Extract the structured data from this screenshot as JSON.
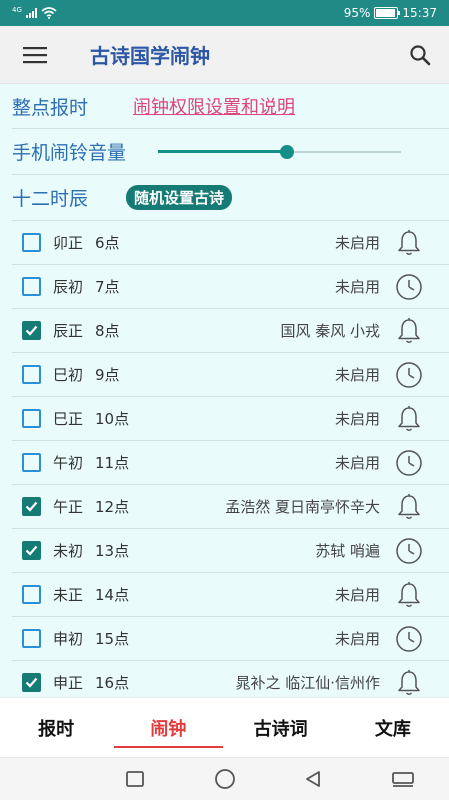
{
  "status_bar": {
    "network": "4G",
    "battery": "95%",
    "battery_level": 0.95,
    "time": "15:37"
  },
  "app_bar": {
    "title": "古诗国学闹钟",
    "menu_icon": "hamburger-menu-icon",
    "search_icon": "search-icon"
  },
  "settings": {
    "hourly_label": "整点报时",
    "permission_link": "闹钟权限设置和说明",
    "volume_label": "手机闹铃音量",
    "volume_level": 0.53,
    "period_label": "十二时辰",
    "random_button": "随机设置古诗"
  },
  "alarms": [
    {
      "slot": "卯正",
      "hour": "6点",
      "poem": "未启用",
      "checked": false,
      "icon": "bell-icon"
    },
    {
      "slot": "辰初",
      "hour": "7点",
      "poem": "未启用",
      "checked": false,
      "icon": "clock-icon"
    },
    {
      "slot": "辰正",
      "hour": "8点",
      "poem": "国风 秦风 小戎",
      "checked": true,
      "icon": "bell-icon"
    },
    {
      "slot": "巳初",
      "hour": "9点",
      "poem": "未启用",
      "checked": false,
      "icon": "clock-icon"
    },
    {
      "slot": "巳正",
      "hour": "10点",
      "poem": "未启用",
      "checked": false,
      "icon": "bell-icon"
    },
    {
      "slot": "午初",
      "hour": "11点",
      "poem": "未启用",
      "checked": false,
      "icon": "clock-icon"
    },
    {
      "slot": "午正",
      "hour": "12点",
      "poem": "孟浩然 夏日南亭怀辛大",
      "checked": true,
      "icon": "bell-icon"
    },
    {
      "slot": "未初",
      "hour": "13点",
      "poem": "苏轼 哨遍",
      "checked": true,
      "icon": "clock-icon"
    },
    {
      "slot": "未正",
      "hour": "14点",
      "poem": "未启用",
      "checked": false,
      "icon": "bell-icon"
    },
    {
      "slot": "申初",
      "hour": "15点",
      "poem": "未启用",
      "checked": false,
      "icon": "clock-icon"
    },
    {
      "slot": "申正",
      "hour": "16点",
      "poem": "晁补之 临江仙·信州作",
      "checked": true,
      "icon": "bell-icon"
    }
  ],
  "tabs": [
    {
      "label": "报时",
      "active": false
    },
    {
      "label": "闹钟",
      "active": true
    },
    {
      "label": "古诗词",
      "active": false
    },
    {
      "label": "文库",
      "active": false
    }
  ],
  "system_nav": [
    "recents-square-icon",
    "home-circle-icon",
    "back-triangle-icon",
    "keyboard-icon"
  ],
  "colors": {
    "status_bar": "#1f8a86",
    "accent": "#157b74",
    "title": "#2d56a5",
    "link": "#e0457b",
    "active_tab": "#e23c3c",
    "list_background": "#e9fbfb"
  }
}
